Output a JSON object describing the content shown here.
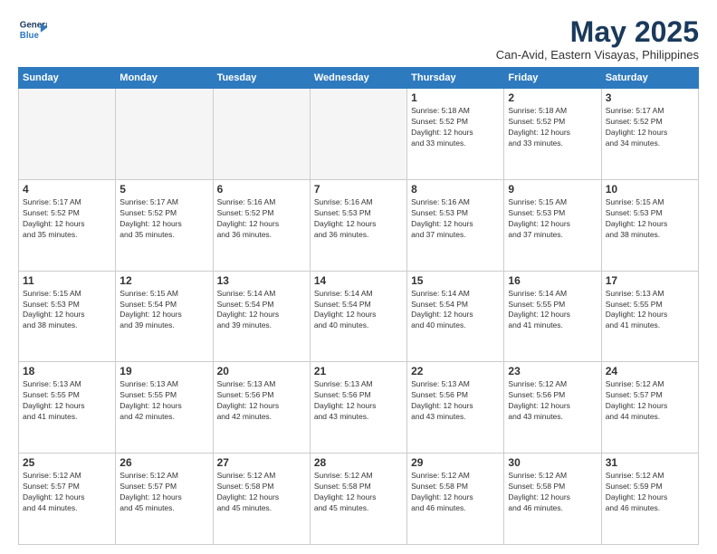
{
  "logo": {
    "line1": "General",
    "line2": "Blue"
  },
  "title": "May 2025",
  "subtitle": "Can-Avid, Eastern Visayas, Philippines",
  "headers": [
    "Sunday",
    "Monday",
    "Tuesday",
    "Wednesday",
    "Thursday",
    "Friday",
    "Saturday"
  ],
  "weeks": [
    [
      {
        "day": "",
        "info": ""
      },
      {
        "day": "",
        "info": ""
      },
      {
        "day": "",
        "info": ""
      },
      {
        "day": "",
        "info": ""
      },
      {
        "day": "1",
        "info": "Sunrise: 5:18 AM\nSunset: 5:52 PM\nDaylight: 12 hours\nand 33 minutes."
      },
      {
        "day": "2",
        "info": "Sunrise: 5:18 AM\nSunset: 5:52 PM\nDaylight: 12 hours\nand 33 minutes."
      },
      {
        "day": "3",
        "info": "Sunrise: 5:17 AM\nSunset: 5:52 PM\nDaylight: 12 hours\nand 34 minutes."
      }
    ],
    [
      {
        "day": "4",
        "info": "Sunrise: 5:17 AM\nSunset: 5:52 PM\nDaylight: 12 hours\nand 35 minutes."
      },
      {
        "day": "5",
        "info": "Sunrise: 5:17 AM\nSunset: 5:52 PM\nDaylight: 12 hours\nand 35 minutes."
      },
      {
        "day": "6",
        "info": "Sunrise: 5:16 AM\nSunset: 5:52 PM\nDaylight: 12 hours\nand 36 minutes."
      },
      {
        "day": "7",
        "info": "Sunrise: 5:16 AM\nSunset: 5:53 PM\nDaylight: 12 hours\nand 36 minutes."
      },
      {
        "day": "8",
        "info": "Sunrise: 5:16 AM\nSunset: 5:53 PM\nDaylight: 12 hours\nand 37 minutes."
      },
      {
        "day": "9",
        "info": "Sunrise: 5:15 AM\nSunset: 5:53 PM\nDaylight: 12 hours\nand 37 minutes."
      },
      {
        "day": "10",
        "info": "Sunrise: 5:15 AM\nSunset: 5:53 PM\nDaylight: 12 hours\nand 38 minutes."
      }
    ],
    [
      {
        "day": "11",
        "info": "Sunrise: 5:15 AM\nSunset: 5:53 PM\nDaylight: 12 hours\nand 38 minutes."
      },
      {
        "day": "12",
        "info": "Sunrise: 5:15 AM\nSunset: 5:54 PM\nDaylight: 12 hours\nand 39 minutes."
      },
      {
        "day": "13",
        "info": "Sunrise: 5:14 AM\nSunset: 5:54 PM\nDaylight: 12 hours\nand 39 minutes."
      },
      {
        "day": "14",
        "info": "Sunrise: 5:14 AM\nSunset: 5:54 PM\nDaylight: 12 hours\nand 40 minutes."
      },
      {
        "day": "15",
        "info": "Sunrise: 5:14 AM\nSunset: 5:54 PM\nDaylight: 12 hours\nand 40 minutes."
      },
      {
        "day": "16",
        "info": "Sunrise: 5:14 AM\nSunset: 5:55 PM\nDaylight: 12 hours\nand 41 minutes."
      },
      {
        "day": "17",
        "info": "Sunrise: 5:13 AM\nSunset: 5:55 PM\nDaylight: 12 hours\nand 41 minutes."
      }
    ],
    [
      {
        "day": "18",
        "info": "Sunrise: 5:13 AM\nSunset: 5:55 PM\nDaylight: 12 hours\nand 41 minutes."
      },
      {
        "day": "19",
        "info": "Sunrise: 5:13 AM\nSunset: 5:55 PM\nDaylight: 12 hours\nand 42 minutes."
      },
      {
        "day": "20",
        "info": "Sunrise: 5:13 AM\nSunset: 5:56 PM\nDaylight: 12 hours\nand 42 minutes."
      },
      {
        "day": "21",
        "info": "Sunrise: 5:13 AM\nSunset: 5:56 PM\nDaylight: 12 hours\nand 43 minutes."
      },
      {
        "day": "22",
        "info": "Sunrise: 5:13 AM\nSunset: 5:56 PM\nDaylight: 12 hours\nand 43 minutes."
      },
      {
        "day": "23",
        "info": "Sunrise: 5:12 AM\nSunset: 5:56 PM\nDaylight: 12 hours\nand 43 minutes."
      },
      {
        "day": "24",
        "info": "Sunrise: 5:12 AM\nSunset: 5:57 PM\nDaylight: 12 hours\nand 44 minutes."
      }
    ],
    [
      {
        "day": "25",
        "info": "Sunrise: 5:12 AM\nSunset: 5:57 PM\nDaylight: 12 hours\nand 44 minutes."
      },
      {
        "day": "26",
        "info": "Sunrise: 5:12 AM\nSunset: 5:57 PM\nDaylight: 12 hours\nand 45 minutes."
      },
      {
        "day": "27",
        "info": "Sunrise: 5:12 AM\nSunset: 5:58 PM\nDaylight: 12 hours\nand 45 minutes."
      },
      {
        "day": "28",
        "info": "Sunrise: 5:12 AM\nSunset: 5:58 PM\nDaylight: 12 hours\nand 45 minutes."
      },
      {
        "day": "29",
        "info": "Sunrise: 5:12 AM\nSunset: 5:58 PM\nDaylight: 12 hours\nand 46 minutes."
      },
      {
        "day": "30",
        "info": "Sunrise: 5:12 AM\nSunset: 5:58 PM\nDaylight: 12 hours\nand 46 minutes."
      },
      {
        "day": "31",
        "info": "Sunrise: 5:12 AM\nSunset: 5:59 PM\nDaylight: 12 hours\nand 46 minutes."
      }
    ]
  ]
}
